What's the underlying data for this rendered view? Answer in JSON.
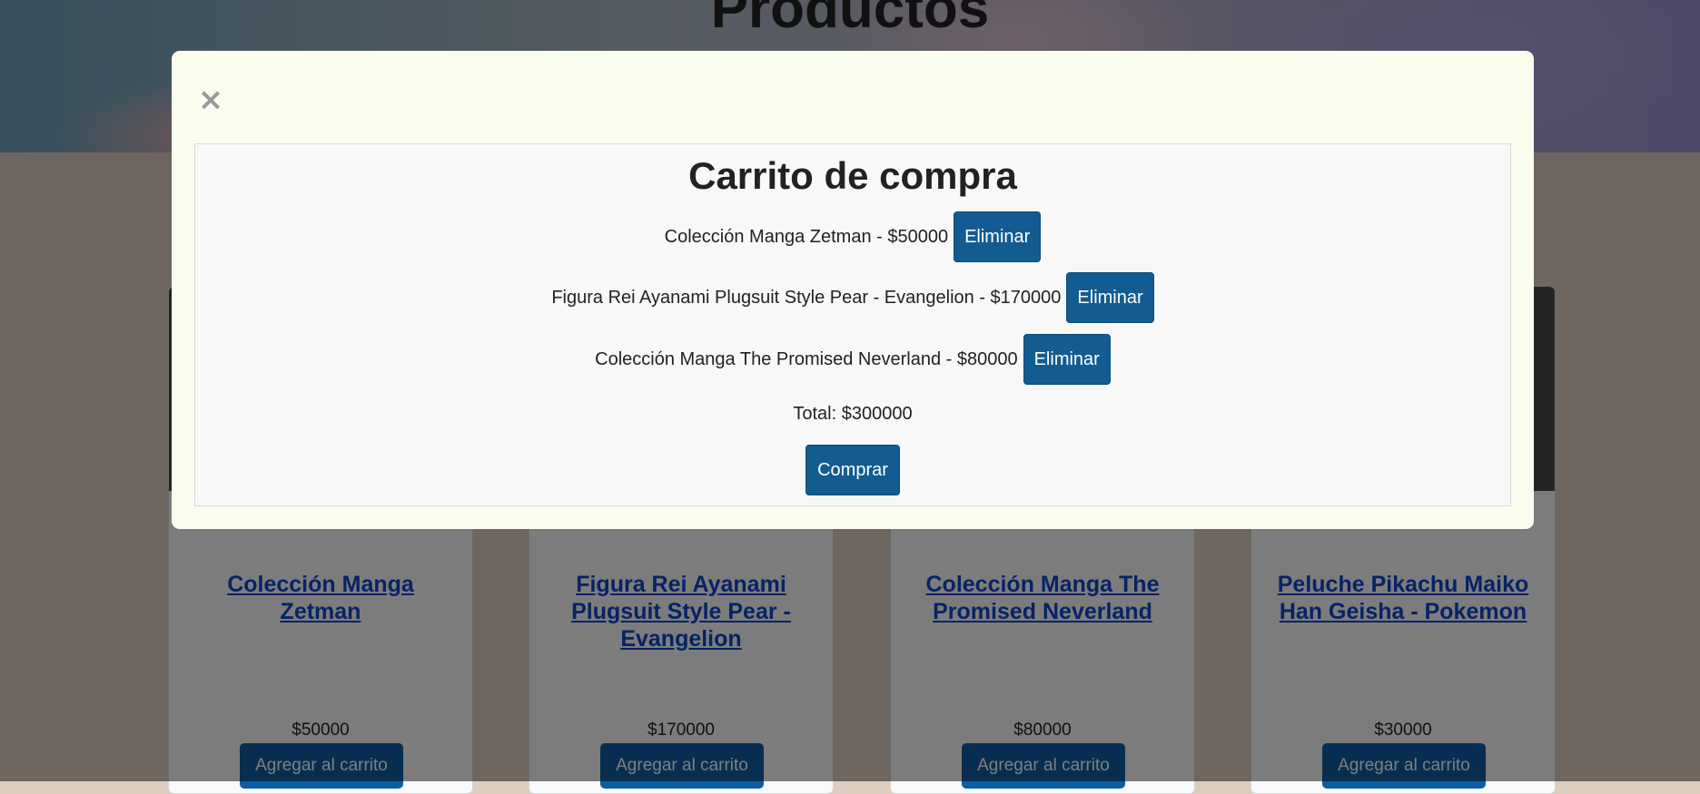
{
  "page": {
    "title": "Productos"
  },
  "products": [
    {
      "name": "Colección Manga Zetman",
      "price": "$50000",
      "button": "Agregar al carrito"
    },
    {
      "name": "Figura Rei Ayanami Plugsuit Style Pear - Evangelion",
      "price": "$170000",
      "button": "Agregar al carrito"
    },
    {
      "name": "Colección Manga The Promised Neverland",
      "price": "$80000",
      "button": "Agregar al carrito"
    },
    {
      "name": "Peluche Pikachu Maiko Han Geisha - Pokemon",
      "price": "$30000",
      "button": "Agregar al carrito"
    }
  ],
  "modal": {
    "close": "×",
    "title": "Carrito de compra",
    "items": [
      {
        "text": "Colección Manga Zetman - $50000",
        "button": "Eliminar"
      },
      {
        "text": "Figura Rei Ayanami Plugsuit Style Pear - Evangelion - $170000",
        "button": "Eliminar"
      },
      {
        "text": "Colección Manga The Promised Neverland - $80000",
        "button": "Eliminar"
      }
    ],
    "total": "Total: $300000",
    "buy_button": "Comprar"
  },
  "colors": {
    "primary": "#135c91",
    "modal_bg": "#f9fdee",
    "link": "#0d47c9"
  }
}
